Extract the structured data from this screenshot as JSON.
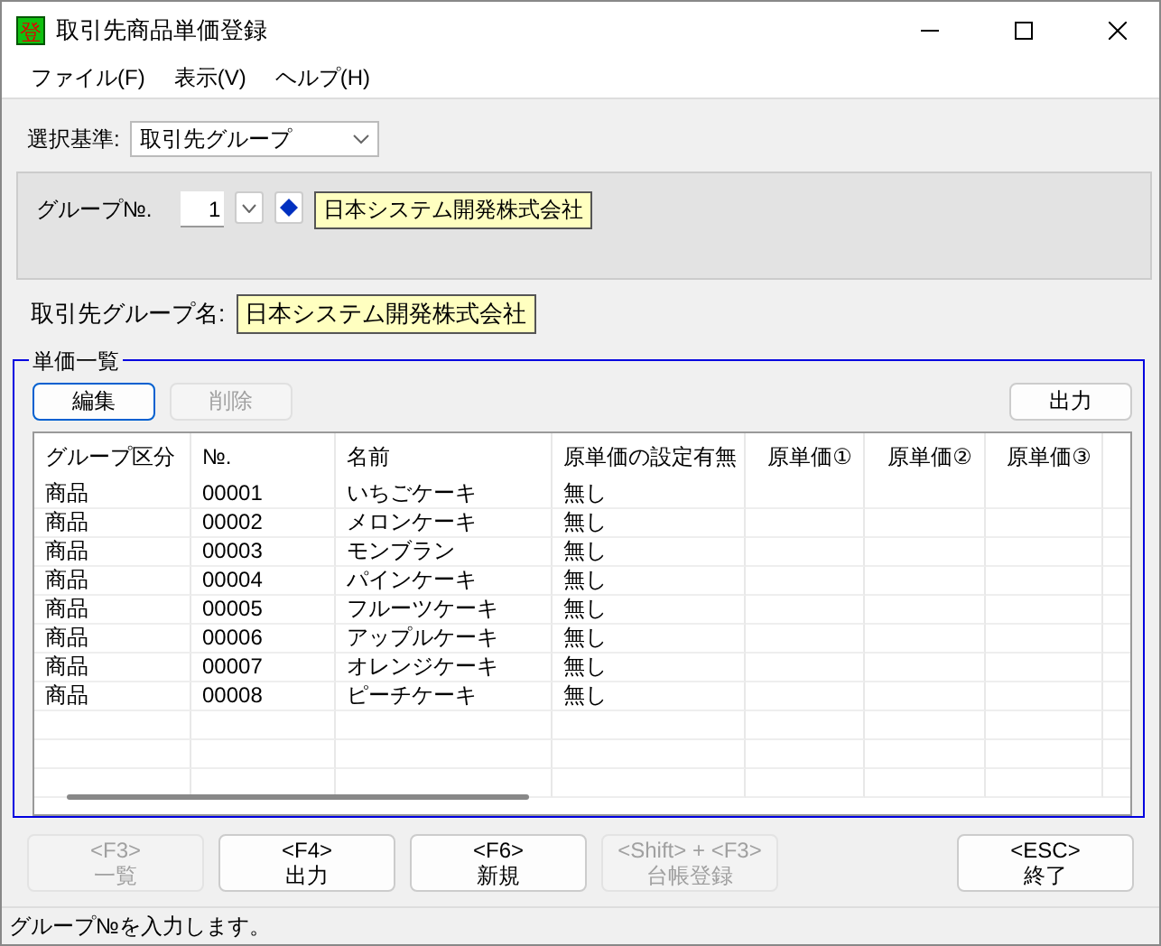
{
  "window": {
    "title": "取引先商品単価登録",
    "icon_char": "登"
  },
  "menu": [
    "ファイル(F)",
    "表示(V)",
    "ヘルプ(H)"
  ],
  "criteria": {
    "label": "選択基準:",
    "value": "取引先グループ"
  },
  "group": {
    "label": "グループ№.",
    "number": "1",
    "name": "日本システム開発株式会社"
  },
  "group_name": {
    "label": "取引先グループ名:",
    "value": "日本システム開発株式会社"
  },
  "price_list": {
    "title": "単価一覧",
    "buttons": [
      {
        "label": "編集",
        "disabled": false,
        "focused": true
      },
      {
        "label": "削除",
        "disabled": true,
        "focused": false
      }
    ],
    "output_button": "出力",
    "columns": [
      "グループ区分",
      "№.",
      "名前",
      "原単価の設定有無",
      "原単価①",
      "原単価②",
      "原単価③"
    ],
    "rows": [
      [
        "商品",
        "00001",
        "いちごケーキ",
        "無し"
      ],
      [
        "商品",
        "00002",
        "メロンケーキ",
        "無し"
      ],
      [
        "商品",
        "00003",
        "モンブラン",
        "無し"
      ],
      [
        "商品",
        "00004",
        "パインケーキ",
        "無し"
      ],
      [
        "商品",
        "00005",
        "フルーツケーキ",
        "無し"
      ],
      [
        "商品",
        "00006",
        "アップルケーキ",
        "無し"
      ],
      [
        "商品",
        "00007",
        "オレンジケーキ",
        "無し"
      ],
      [
        "商品",
        "00008",
        "ピーチケーキ",
        "無し"
      ]
    ]
  },
  "function_keys": [
    {
      "key": "<F3>",
      "label": "一覧",
      "disabled": true
    },
    {
      "key": "<F4>",
      "label": "出力",
      "disabled": false
    },
    {
      "key": "<F6>",
      "label": "新規",
      "disabled": false
    },
    {
      "key": "<Shift> + <F3>",
      "label": "台帳登録",
      "disabled": true
    },
    {
      "key": "<ESC>",
      "label": "終了",
      "disabled": false
    }
  ],
  "status_bar": "グループ№を入力します。"
}
